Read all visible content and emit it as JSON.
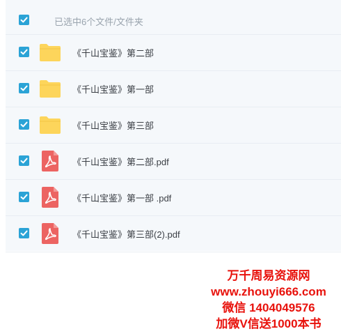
{
  "header": {
    "selected_label": "已选中6个文件/文件夹",
    "select_all_checked": true
  },
  "files": [
    {
      "name": "《千山宝鉴》第二部",
      "type": "folder",
      "checked": true
    },
    {
      "name": "《千山宝鉴》第一部",
      "type": "folder",
      "checked": true
    },
    {
      "name": "《千山宝鉴》第三部",
      "type": "folder",
      "checked": true
    },
    {
      "name": "《千山宝鉴》第二部.pdf",
      "type": "pdf",
      "checked": true
    },
    {
      "name": "《千山宝鉴》第一部 .pdf",
      "type": "pdf",
      "checked": true
    },
    {
      "name": "《千山宝鉴》第三部(2).pdf",
      "type": "pdf",
      "checked": true
    }
  ],
  "watermark": {
    "line1": "万千周易资源网",
    "line2": "www.zhouyi666.com",
    "line3": "微信 1404049576",
    "line4": "加微V信送1000本书"
  },
  "colors": {
    "checkbox": "#2ba3d6",
    "folder": "#fdd55b",
    "pdf": "#ec6462",
    "watermark": "#e8120c"
  },
  "icons": {
    "folder": "folder-icon",
    "pdf": "pdf-file-icon",
    "checkbox": "checkmark-icon"
  }
}
